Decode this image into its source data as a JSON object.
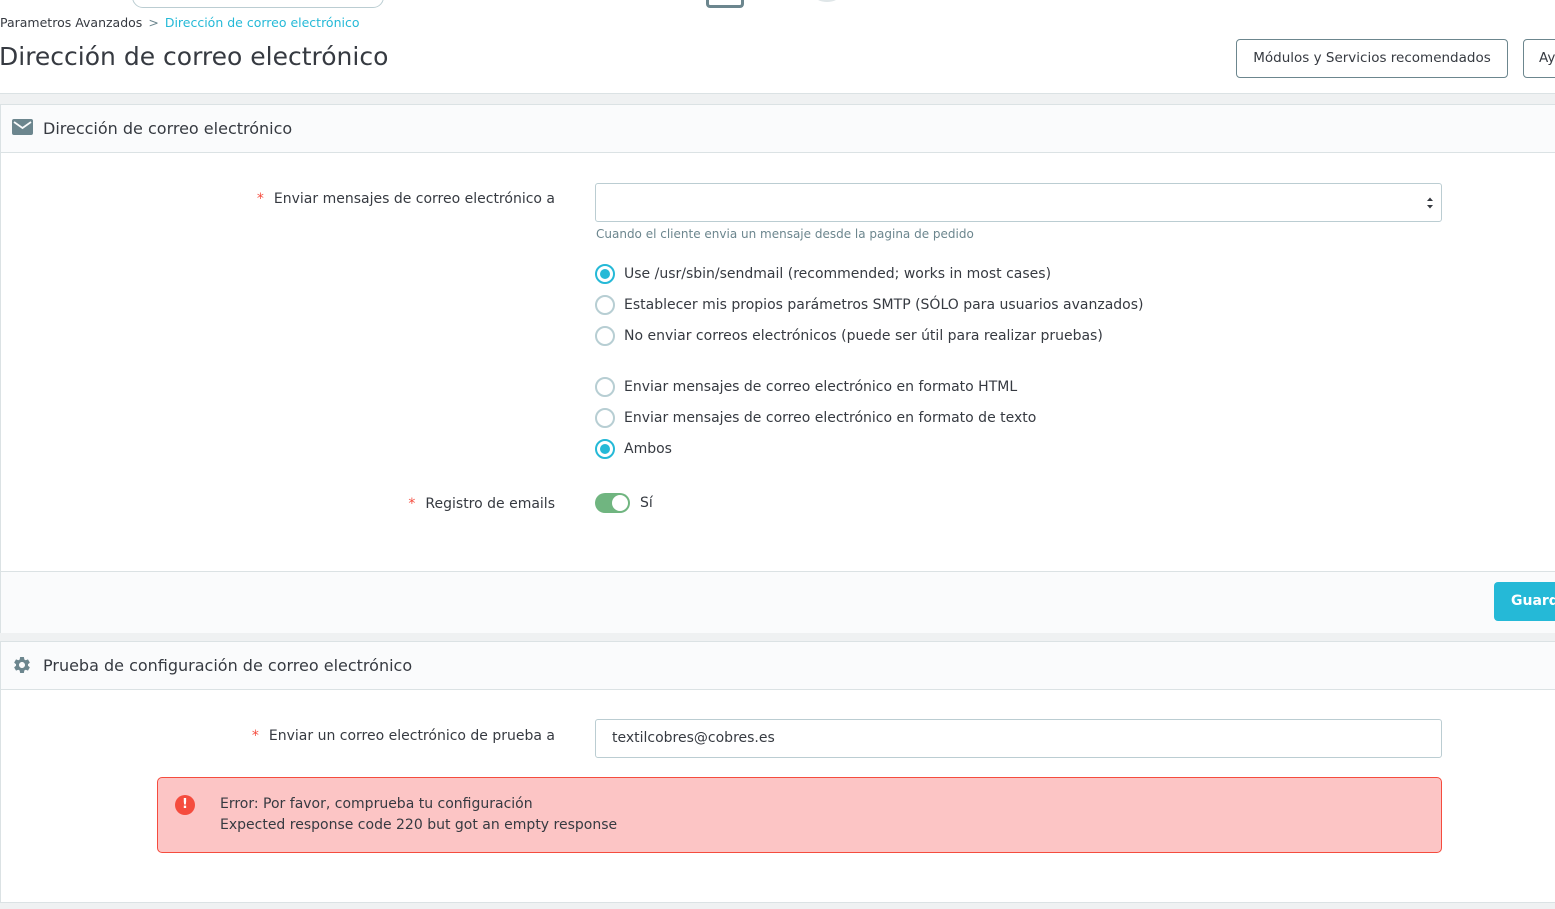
{
  "breadcrumb": {
    "parent": "Parametros Avanzados",
    "separator": ">",
    "current": "Dirección de correo electrónico"
  },
  "page": {
    "title": "Dirección de correo electrónico"
  },
  "toolbar": {
    "recommended_label": "Módulos y Servicios recomendados",
    "help_label": "Ay"
  },
  "email_panel": {
    "heading": "Dirección de correo electrónico",
    "heading_icon": "envelope-icon",
    "send_to": {
      "required_mark": "*",
      "label": "Enviar mensajes de correo electrónico a",
      "value": "",
      "help": "Cuando el cliente envia un mensaje desde la pagina de pedido"
    },
    "mail_method": [
      {
        "label": "Use /usr/sbin/sendmail (recommended; works in most cases)",
        "checked": true
      },
      {
        "label": "Establecer mis propios parámetros SMTP (SÓLO para usuarios avanzados)",
        "checked": false
      },
      {
        "label": "No enviar correos electrónicos (puede ser útil para realizar pruebas)",
        "checked": false
      }
    ],
    "mail_format": [
      {
        "label": "Enviar mensajes de correo electrónico en formato HTML",
        "checked": false
      },
      {
        "label": "Enviar mensajes de correo electrónico en formato de texto",
        "checked": false
      },
      {
        "label": "Ambos",
        "checked": true
      }
    ],
    "log_emails": {
      "required_mark": "*",
      "label": "Registro de emails",
      "value_label": "Sí",
      "on": true
    },
    "save_label": "Guarda"
  },
  "test_panel": {
    "heading": "Prueba de configuración de correo electrónico",
    "heading_icon": "gear-icon",
    "test_email": {
      "required_mark": "*",
      "label": "Enviar un correo electrónico de prueba a",
      "value": "textilcobres@cobres.es"
    },
    "error": {
      "icon": "!",
      "line1": "Error: Por favor, comprueba tu configuración",
      "line2": "Expected response code 220 but got an empty response"
    }
  },
  "colors": {
    "accent": "#25b9d7",
    "toggle_on": "#70b580",
    "error_bg": "#fcc5c5",
    "error_border": "#f54c3e",
    "required": "#f54c3e"
  }
}
